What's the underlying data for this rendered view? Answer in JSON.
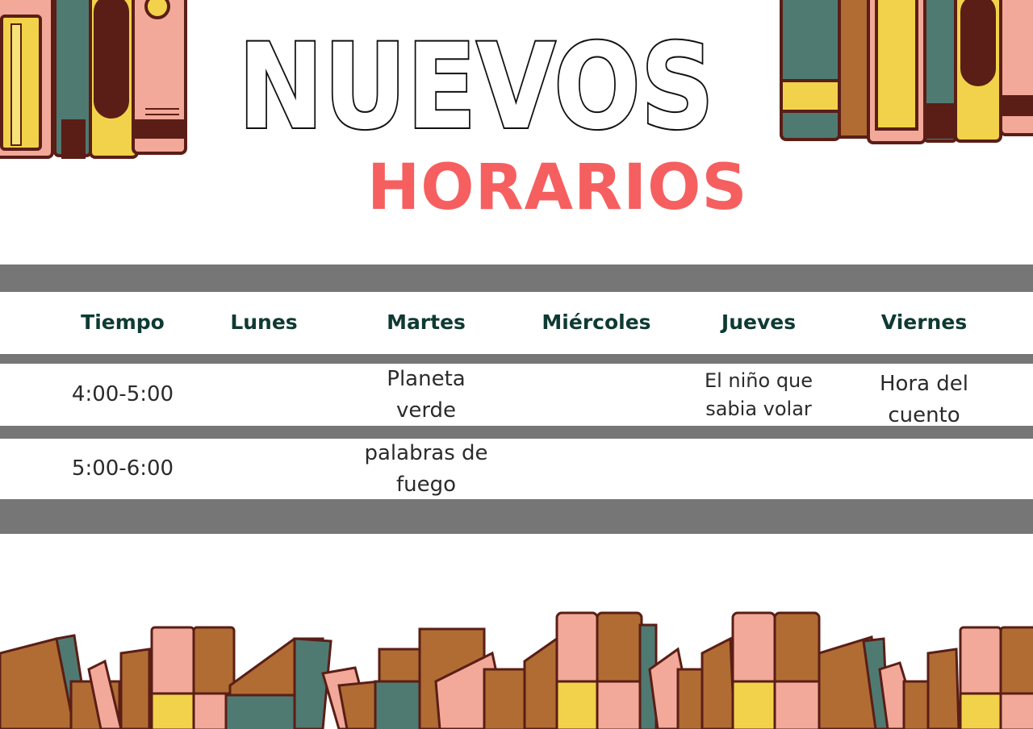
{
  "header": {
    "title": "NUEVOS",
    "subtitle": "HORARIOS"
  },
  "colors": {
    "title_stroke": "#111111",
    "subtitle": "#f65f5f",
    "header_text": "#0f3a33",
    "body_text": "#2b2b2b",
    "bars": "#767676",
    "book_pink": "#f3a999",
    "book_teal": "#4f7a72",
    "book_yellow": "#f2d24a",
    "book_brown": "#5a1e16",
    "book_wood": "#b06c33"
  },
  "schedule": {
    "headers": [
      "Tiempo",
      "Lunes",
      "Martes",
      "Miércoles",
      "Jueves",
      "Viernes"
    ],
    "rows": [
      {
        "time": "4:00-5:00",
        "lunes": "",
        "martes": "Planeta\nverde",
        "miercoles": "",
        "jueves": "El niño que\nsabia volar",
        "viernes": "Hora del\ncuento"
      },
      {
        "time": "5:00-6:00",
        "lunes": "",
        "martes": "palabras de\nfuego",
        "miercoles": "",
        "jueves": "",
        "viernes": ""
      }
    ]
  },
  "decorations": {
    "top_left": "books-icon",
    "top_right": "books-icon",
    "bottom": "bookshelf-icon"
  }
}
